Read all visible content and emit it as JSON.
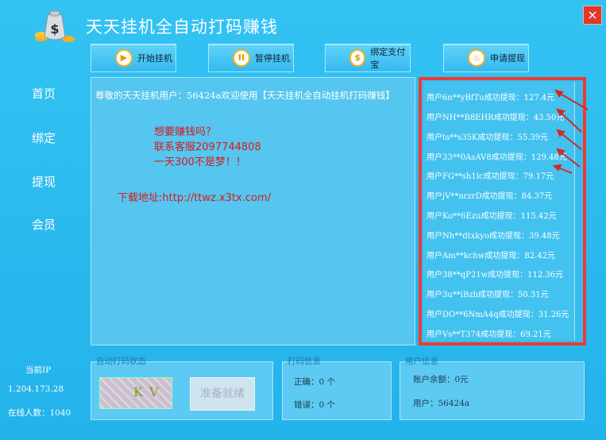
{
  "window": {
    "title": "天天挂机全自动打码赚钱",
    "close_glyph": "×"
  },
  "toolbar": [
    {
      "label": "开始挂机",
      "icon": "play-icon",
      "glyph": "▶"
    },
    {
      "label": "暂停挂机",
      "icon": "pause-icon",
      "glyph": "II"
    },
    {
      "label": "绑定支付宝",
      "icon": "dollar-icon",
      "glyph": "$"
    },
    {
      "label": "申请提现",
      "icon": "money-bag-icon",
      "glyph": "♨"
    }
  ],
  "nav": [
    "首页",
    "绑定",
    "提现",
    "会员"
  ],
  "main": {
    "welcome": "尊敬的天天挂机用户：56424a欢迎使用【天天挂机全自动挂机打码赚钱】",
    "ad_lines": [
      "想要赚钱吗？",
      "联系客服2097744808",
      "一天300不是梦！！"
    ],
    "download": "下载地址:http://ttwz.x3tx.com/"
  },
  "withdrawals": [
    "用户6n**yBfTu成功提现：127.4元",
    "用户NH**B8EHR成功提现：43.50元",
    "用户ts**s35K成功提现：55.39元",
    "用户33**0AsAV8成功提现：129.48元",
    "用户FG**sh1lc成功提现：79.17元",
    "用户jV**nrzrD成功提现：84.37元",
    "用户Ko**6Ezu成功提现：115.42元",
    "用户Nh**dtxkyo成功提现：39.48元",
    "用户Am**kchw成功提现：82.42元",
    "用户38**qP21w成功提现：112.36元",
    "用户3u**iBzh成功提现：50.31元",
    "用户DO**6NmA4q成功提现：31.26元",
    "用户Vs**T374成功提现：69.21元"
  ],
  "status": {
    "ip_label": "当前IP",
    "ip": "1.204.173.28",
    "online": "在线人数：1040"
  },
  "auto_box": {
    "title": "自动打码状态",
    "captcha": "KV",
    "ready": "准备就绪"
  },
  "code_box": {
    "title": "打码信息",
    "correct": "正确：0 个",
    "wrong": "错误：0 个"
  },
  "user_box": {
    "title": "用户信息",
    "balance": "账户余额：0元",
    "user": "用户：56424a"
  },
  "colors": {
    "accent": "#2fbdf0",
    "highlight": "#ec3b34",
    "ad_text": "#d9191c"
  }
}
